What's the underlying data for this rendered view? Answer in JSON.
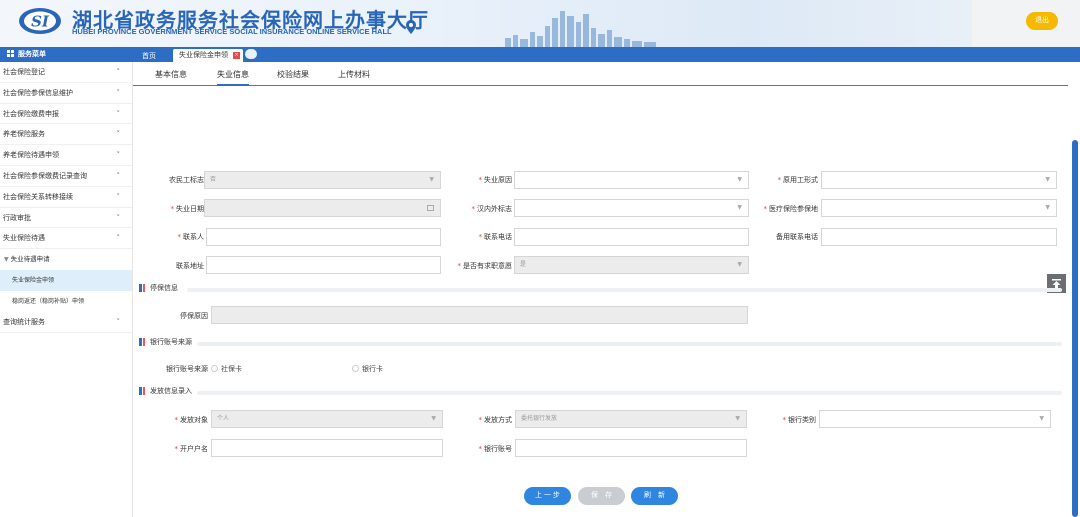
{
  "header": {
    "title_cn": "湖北省政务服务社会保险网上办事大厅",
    "title_en": "HUBEI PROVINCE GOVERNMENT SERVICE SOCIAL INSURANCE ONLINE SERVICE HALL",
    "logo_text": "SI",
    "logout_label": "退出"
  },
  "sidebar": {
    "title": "服务菜单",
    "items": [
      {
        "label": "社会保险登记",
        "chevron": "˅"
      },
      {
        "label": "社会保险参保信息维护",
        "chevron": "˅"
      },
      {
        "label": "社会保险缴费申报",
        "chevron": "˅"
      },
      {
        "label": "养老保险服务",
        "chevron": "˅"
      },
      {
        "label": "养老保险待遇申领",
        "chevron": "˅"
      },
      {
        "label": "社会保险参保缴费记录查询",
        "chevron": "˅"
      },
      {
        "label": "社会保险关系转移接续",
        "chevron": "˅"
      },
      {
        "label": "行政审批",
        "chevron": "˅"
      },
      {
        "label": "失业保险待遇",
        "chevron": "˄"
      }
    ],
    "sub_group": "失业待遇申请",
    "sub_items": [
      "失业保险金申领",
      "稳岗返还（稳岗补贴）申领"
    ],
    "last_item": {
      "label": "查询统计服务",
      "chevron": "˅"
    }
  },
  "tabs": {
    "home": "首页",
    "active": "失业保险金申领",
    "close": "×"
  },
  "subtabs": [
    "基本信息",
    "失业信息",
    "校验结果",
    "上传材料"
  ],
  "form": {
    "farmer_flag_label": "农民工标志",
    "farmer_flag_value": "否",
    "unemp_reason_label": "失业原因",
    "employ_form_label": "原用工形式",
    "unemp_date_label": "失业日期",
    "inside_outside_label": "汉内外标志",
    "medical_place_label": "医疗保险参保地",
    "contact_label": "联系人",
    "phone_label": "联系电话",
    "alt_phone_label": "备用联系电话",
    "address_label": "联系地址",
    "job_intent_label": "是否有求职意愿",
    "job_intent_value": "是",
    "required_mark": "*",
    "arrow": "▼"
  },
  "sections": {
    "stop_insurance": "停保信息",
    "stop_reason_label": "停保原因",
    "bank_source": "银行账号来源",
    "bank_source_label": "银行账号来源",
    "radio_social_card": "社保卡",
    "radio_bank_card": "银行卡",
    "payment": "发放信息录入",
    "pay_target_label": "发放对象",
    "pay_target_value": "个人",
    "pay_method_label": "发放方式",
    "pay_method_value": "委托银行发放",
    "bank_type_label": "银行类别",
    "account_name_label": "开户户名",
    "account_no_label": "银行账号"
  },
  "buttons": {
    "prev": "上 一 步",
    "save": "保　存",
    "refresh": "刷　新"
  }
}
